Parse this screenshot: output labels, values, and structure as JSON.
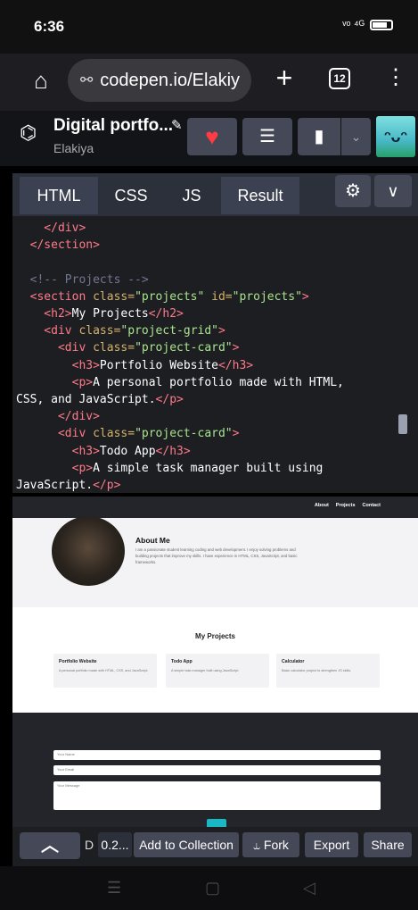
{
  "status": {
    "time": "6:36",
    "signal": "ᵛᵒ ⁴ᴳ",
    "battery": ""
  },
  "browser": {
    "url": "codepen.io/Elakiy",
    "tabs_count": "12"
  },
  "codepen": {
    "title": "Digital portfo...",
    "author": "Elakiya",
    "tabs": [
      "HTML",
      "CSS",
      "JS",
      "Result"
    ]
  },
  "code_lines": [
    [
      {
        "c": "tag",
        "t": "    </div>"
      }
    ],
    [
      {
        "c": "tag",
        "t": "  </section>"
      }
    ],
    [
      {
        "c": "txt",
        "t": ""
      }
    ],
    [
      {
        "c": "cmt",
        "t": "  <!-- Projects -->"
      }
    ],
    [
      {
        "c": "tag",
        "t": "  <section "
      },
      {
        "c": "attr",
        "t": "class="
      },
      {
        "c": "val",
        "t": "\"projects\" "
      },
      {
        "c": "attr",
        "t": "id="
      },
      {
        "c": "val",
        "t": "\"projects\""
      },
      {
        "c": "tag",
        "t": ">"
      }
    ],
    [
      {
        "c": "tag",
        "t": "    <h2>"
      },
      {
        "c": "txt",
        "t": "My Projects"
      },
      {
        "c": "tag",
        "t": "</h2>"
      }
    ],
    [
      {
        "c": "tag",
        "t": "    <div "
      },
      {
        "c": "attr",
        "t": "class="
      },
      {
        "c": "val",
        "t": "\"project-grid\""
      },
      {
        "c": "tag",
        "t": ">"
      }
    ],
    [
      {
        "c": "tag",
        "t": "      <div "
      },
      {
        "c": "attr",
        "t": "class="
      },
      {
        "c": "val",
        "t": "\"project-card\""
      },
      {
        "c": "tag",
        "t": ">"
      }
    ],
    [
      {
        "c": "tag",
        "t": "        <h3>"
      },
      {
        "c": "txt",
        "t": "Portfolio Website"
      },
      {
        "c": "tag",
        "t": "</h3>"
      }
    ],
    [
      {
        "c": "tag",
        "t": "        <p>"
      },
      {
        "c": "txt",
        "t": "A personal portfolio made with HTML,"
      }
    ],
    [
      {
        "c": "txt",
        "t": "CSS, and JavaScript."
      },
      {
        "c": "tag",
        "t": "</p>"
      }
    ],
    [
      {
        "c": "tag",
        "t": "      </div>"
      }
    ],
    [
      {
        "c": "tag",
        "t": "      <div "
      },
      {
        "c": "attr",
        "t": "class="
      },
      {
        "c": "val",
        "t": "\"project-card\""
      },
      {
        "c": "tag",
        "t": ">"
      }
    ],
    [
      {
        "c": "tag",
        "t": "        <h3>"
      },
      {
        "c": "txt",
        "t": "Todo App"
      },
      {
        "c": "tag",
        "t": "</h3>"
      }
    ],
    [
      {
        "c": "tag",
        "t": "        <p>"
      },
      {
        "c": "txt",
        "t": "A simple task manager built using"
      }
    ],
    [
      {
        "c": "txt",
        "t": "JavaScript."
      },
      {
        "c": "tag",
        "t": "</p>"
      }
    ]
  ],
  "preview": {
    "nav": [
      "About",
      "Projects",
      "Contact"
    ],
    "about_title": "About Me",
    "about_text": "I am a passionate student learning coding and web development. I enjoy solving problems and building projects that improve my skills. I have experience in HTML, CSS, JavaScript, and basic frameworks.",
    "projects_title": "My Projects",
    "cards": [
      {
        "title": "Portfolio Website",
        "desc": "A personal portfolio made with HTML, CSS, and JavaScript."
      },
      {
        "title": "Todo App",
        "desc": "A simple task manager built using JavaScript."
      },
      {
        "title": "Calculator",
        "desc": "Basic calculator project to strengthen JS skills."
      }
    ],
    "placeholders": {
      "name": "Your Name",
      "email": "Your Email",
      "message": "Your Message"
    }
  },
  "bottom_bar": {
    "d_label": "D",
    "version": "0.2...",
    "collection": "Add to Collection",
    "fork": "Fork",
    "export": "Export",
    "share": "Share"
  },
  "icons": {
    "home": "home-icon",
    "url_tune": "tune-icon",
    "plus": "plus-icon",
    "menu": "kebab-menu-icon",
    "logo": "codepen-logo-icon",
    "heart": "heart-icon",
    "layout": "layout-icon",
    "bookmark": "bookmark-icon",
    "gear": "gear-icon",
    "chevron": "chevron-down-icon",
    "up": "chevron-up-icon",
    "fork": "fork-icon"
  },
  "colors": {
    "accent_heart": "#ff3c41",
    "tab_active": "#3b4150",
    "editor_bg": "#1d1e22"
  }
}
